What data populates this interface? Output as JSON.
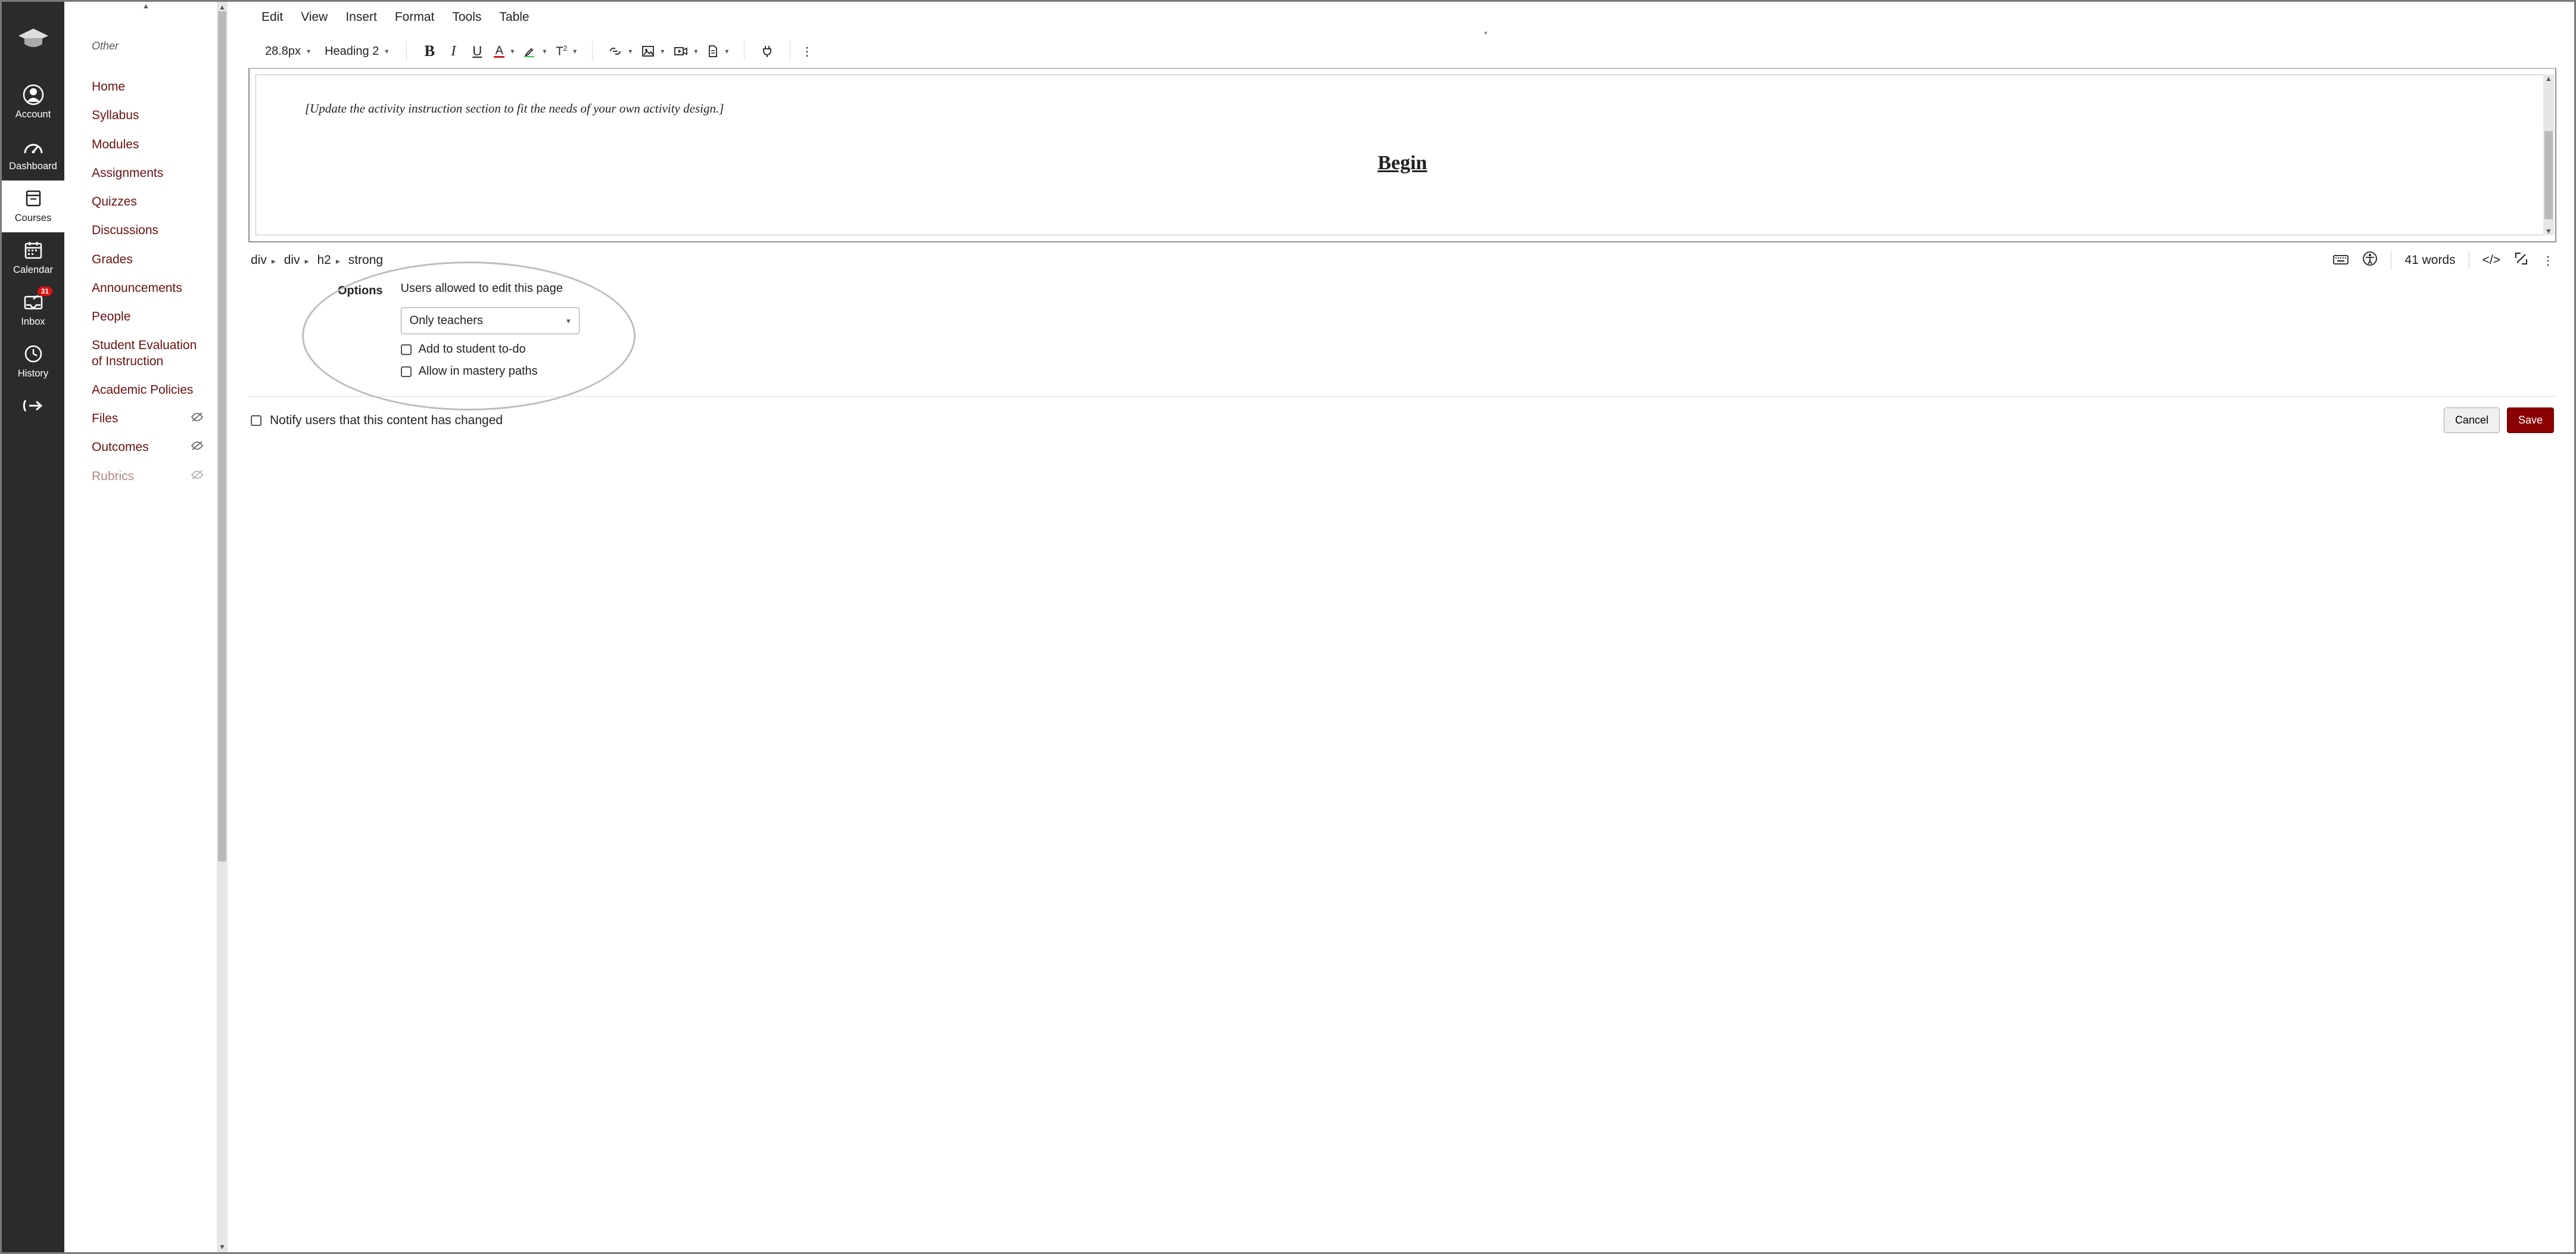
{
  "global_nav": {
    "items": [
      {
        "label": "Account",
        "icon": "user-icon"
      },
      {
        "label": "Dashboard",
        "icon": "gauge-icon"
      },
      {
        "label": "Courses",
        "icon": "book-icon"
      },
      {
        "label": "Calendar",
        "icon": "calendar-icon"
      },
      {
        "label": "Inbox",
        "icon": "inbox-icon",
        "badge": "31"
      },
      {
        "label": "History",
        "icon": "clock-icon"
      }
    ],
    "active_index": 2
  },
  "course_nav": {
    "section_label": "Other",
    "items": [
      {
        "label": "Home"
      },
      {
        "label": "Syllabus"
      },
      {
        "label": "Modules"
      },
      {
        "label": "Assignments"
      },
      {
        "label": "Quizzes"
      },
      {
        "label": "Discussions"
      },
      {
        "label": "Grades"
      },
      {
        "label": "Announcements"
      },
      {
        "label": "People"
      },
      {
        "label": "Student Evaluation of Instruction"
      },
      {
        "label": "Academic Policies"
      },
      {
        "label": "Files",
        "hidden": true
      },
      {
        "label": "Outcomes",
        "hidden": true
      },
      {
        "label": "Rubrics",
        "hidden": true
      }
    ]
  },
  "editor": {
    "menubar": [
      "Edit",
      "View",
      "Insert",
      "Format",
      "Tools",
      "Table"
    ],
    "font_size": "28.8px",
    "block_format": "Heading 2",
    "content_hint": "[Update the activity instruction section to fit the needs of your own activity design.]",
    "content_link": "Begin",
    "breadcrumb": [
      "div",
      "div",
      "h2",
      "strong"
    ],
    "word_count": "41 words"
  },
  "options": {
    "heading": "Options",
    "edit_label": "Users allowed to edit this page",
    "edit_select_value": "Only teachers",
    "todo_label": "Add to student to-do",
    "mastery_label": "Allow in mastery paths"
  },
  "footer": {
    "notify_label": "Notify users that this content has changed",
    "cancel": "Cancel",
    "save": "Save"
  }
}
